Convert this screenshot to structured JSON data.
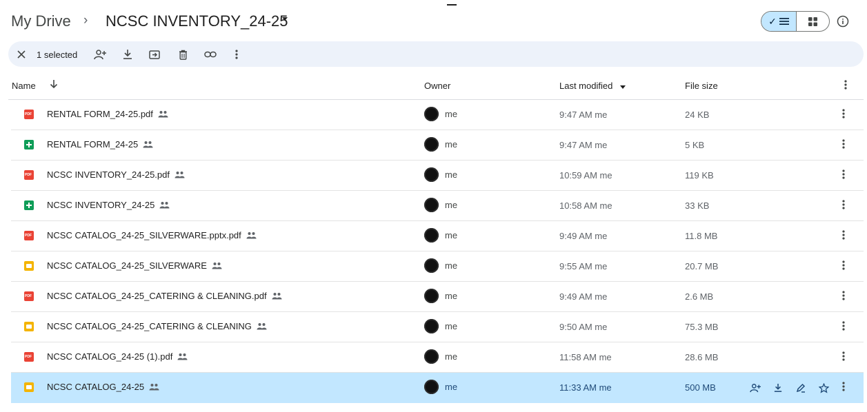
{
  "breadcrumb": {
    "root": "My Drive",
    "separator": "›",
    "current": "NCSC INVENTORY_24-25"
  },
  "view_toggle": {
    "list_check": "✓",
    "selected_view": "list"
  },
  "toolbar": {
    "selected_text": "1 selected"
  },
  "columns": {
    "name": "Name",
    "owner": "Owner",
    "last_modified": "Last modified",
    "file_size": "File size"
  },
  "files": [
    {
      "name": "RENTAL FORM_24-25.pdf",
      "type": "pdf",
      "owner": "me",
      "modified": "9:47 AM me",
      "size": "24 KB"
    },
    {
      "name": "RENTAL FORM_24-25",
      "type": "sheet",
      "owner": "me",
      "modified": "9:47 AM me",
      "size": "5 KB"
    },
    {
      "name": "NCSC INVENTORY_24-25.pdf",
      "type": "pdf",
      "owner": "me",
      "modified": "10:59 AM me",
      "size": "119 KB"
    },
    {
      "name": "NCSC INVENTORY_24-25",
      "type": "sheet",
      "owner": "me",
      "modified": "10:58 AM me",
      "size": "33 KB"
    },
    {
      "name": "NCSC CATALOG_24-25_SILVERWARE.pptx.pdf",
      "type": "pdf",
      "owner": "me",
      "modified": "9:49 AM me",
      "size": "11.8 MB"
    },
    {
      "name": "NCSC CATALOG_24-25_SILVERWARE",
      "type": "slide",
      "owner": "me",
      "modified": "9:55 AM me",
      "size": "20.7 MB"
    },
    {
      "name": "NCSC CATALOG_24-25_CATERING & CLEANING.pdf",
      "type": "pdf",
      "owner": "me",
      "modified": "9:49 AM me",
      "size": "2.6 MB"
    },
    {
      "name": "NCSC CATALOG_24-25_CATERING & CLEANING",
      "type": "slide",
      "owner": "me",
      "modified": "9:50 AM me",
      "size": "75.3 MB"
    },
    {
      "name": "NCSC CATALOG_24-25 (1).pdf",
      "type": "pdf",
      "owner": "me",
      "modified": "11:58 AM me",
      "size": "28.6 MB"
    },
    {
      "name": "NCSC CATALOG_24-25",
      "type": "slide",
      "owner": "me",
      "modified": "11:33 AM me",
      "size": "500 MB",
      "selected": true
    }
  ],
  "colors": {
    "selected_row": "#c2e7ff",
    "toolbar_bg": "#edf2fa",
    "pdf_icon": "#ea4335",
    "sheet_icon": "#0f9d58",
    "slide_icon": "#f4b400"
  },
  "icons": {
    "file_types": {
      "pdf": "pdf-file-icon",
      "sheet": "google-sheets-icon",
      "slide": "google-slides-icon"
    },
    "shared": "shared-people-icon"
  }
}
